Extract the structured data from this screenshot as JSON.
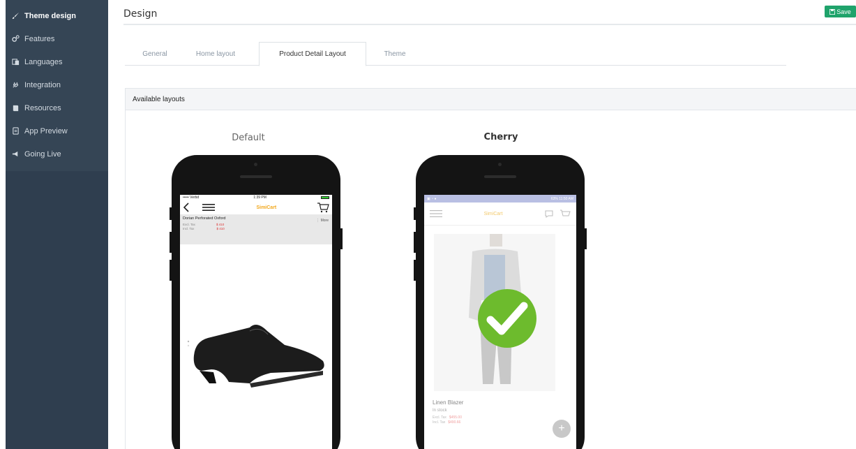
{
  "sidebar": {
    "items": [
      {
        "label": "Theme design",
        "icon": "brush-icon"
      },
      {
        "label": "Features",
        "icon": "gears-icon"
      },
      {
        "label": "Languages",
        "icon": "translate-icon"
      },
      {
        "label": "Integration",
        "icon": "plug-icon"
      },
      {
        "label": "Resources",
        "icon": "book-icon"
      },
      {
        "label": "App Preview",
        "icon": "tablet-icon"
      },
      {
        "label": "Going Live",
        "icon": "megaphone-icon"
      }
    ]
  },
  "header": {
    "title": "Design",
    "save_label": "Save"
  },
  "tabs": [
    {
      "label": "General"
    },
    {
      "label": "Home layout"
    },
    {
      "label": "Product Detail Layout",
      "active": true
    },
    {
      "label": "Theme"
    }
  ],
  "panel": {
    "title": "Available layouts",
    "layouts": [
      {
        "name": "Default",
        "screen": {
          "carrier": "••••• Verbd",
          "time": "1:39 PM",
          "logo": "SimiCart",
          "product_name": "Dorian Perforated Oxford",
          "excl_tax_label": "Excl. Tax",
          "excl_tax_price": "$ 410",
          "incl_tax_label": "Incl. Tax",
          "incl_tax_price": "$ 410",
          "more_label": "More"
        }
      },
      {
        "name": "Cherry",
        "selected": true,
        "screen": {
          "status_time": "11:50 AM",
          "status_battery": "63%",
          "logo": "SimiCart",
          "product_name": "Linen Blazer",
          "stock": "In stock",
          "excl_tax_label": "Excl. Tax",
          "excl_tax_price": "$455.00",
          "incl_tax_label": "Incl. Tax",
          "incl_tax_price": "$490.66",
          "fab_label": "+"
        }
      }
    ]
  },
  "colors": {
    "sidebar": "#354555",
    "save": "#1fa36b",
    "check": "#6dbb2d",
    "accent_logo": "#f2a81d"
  }
}
